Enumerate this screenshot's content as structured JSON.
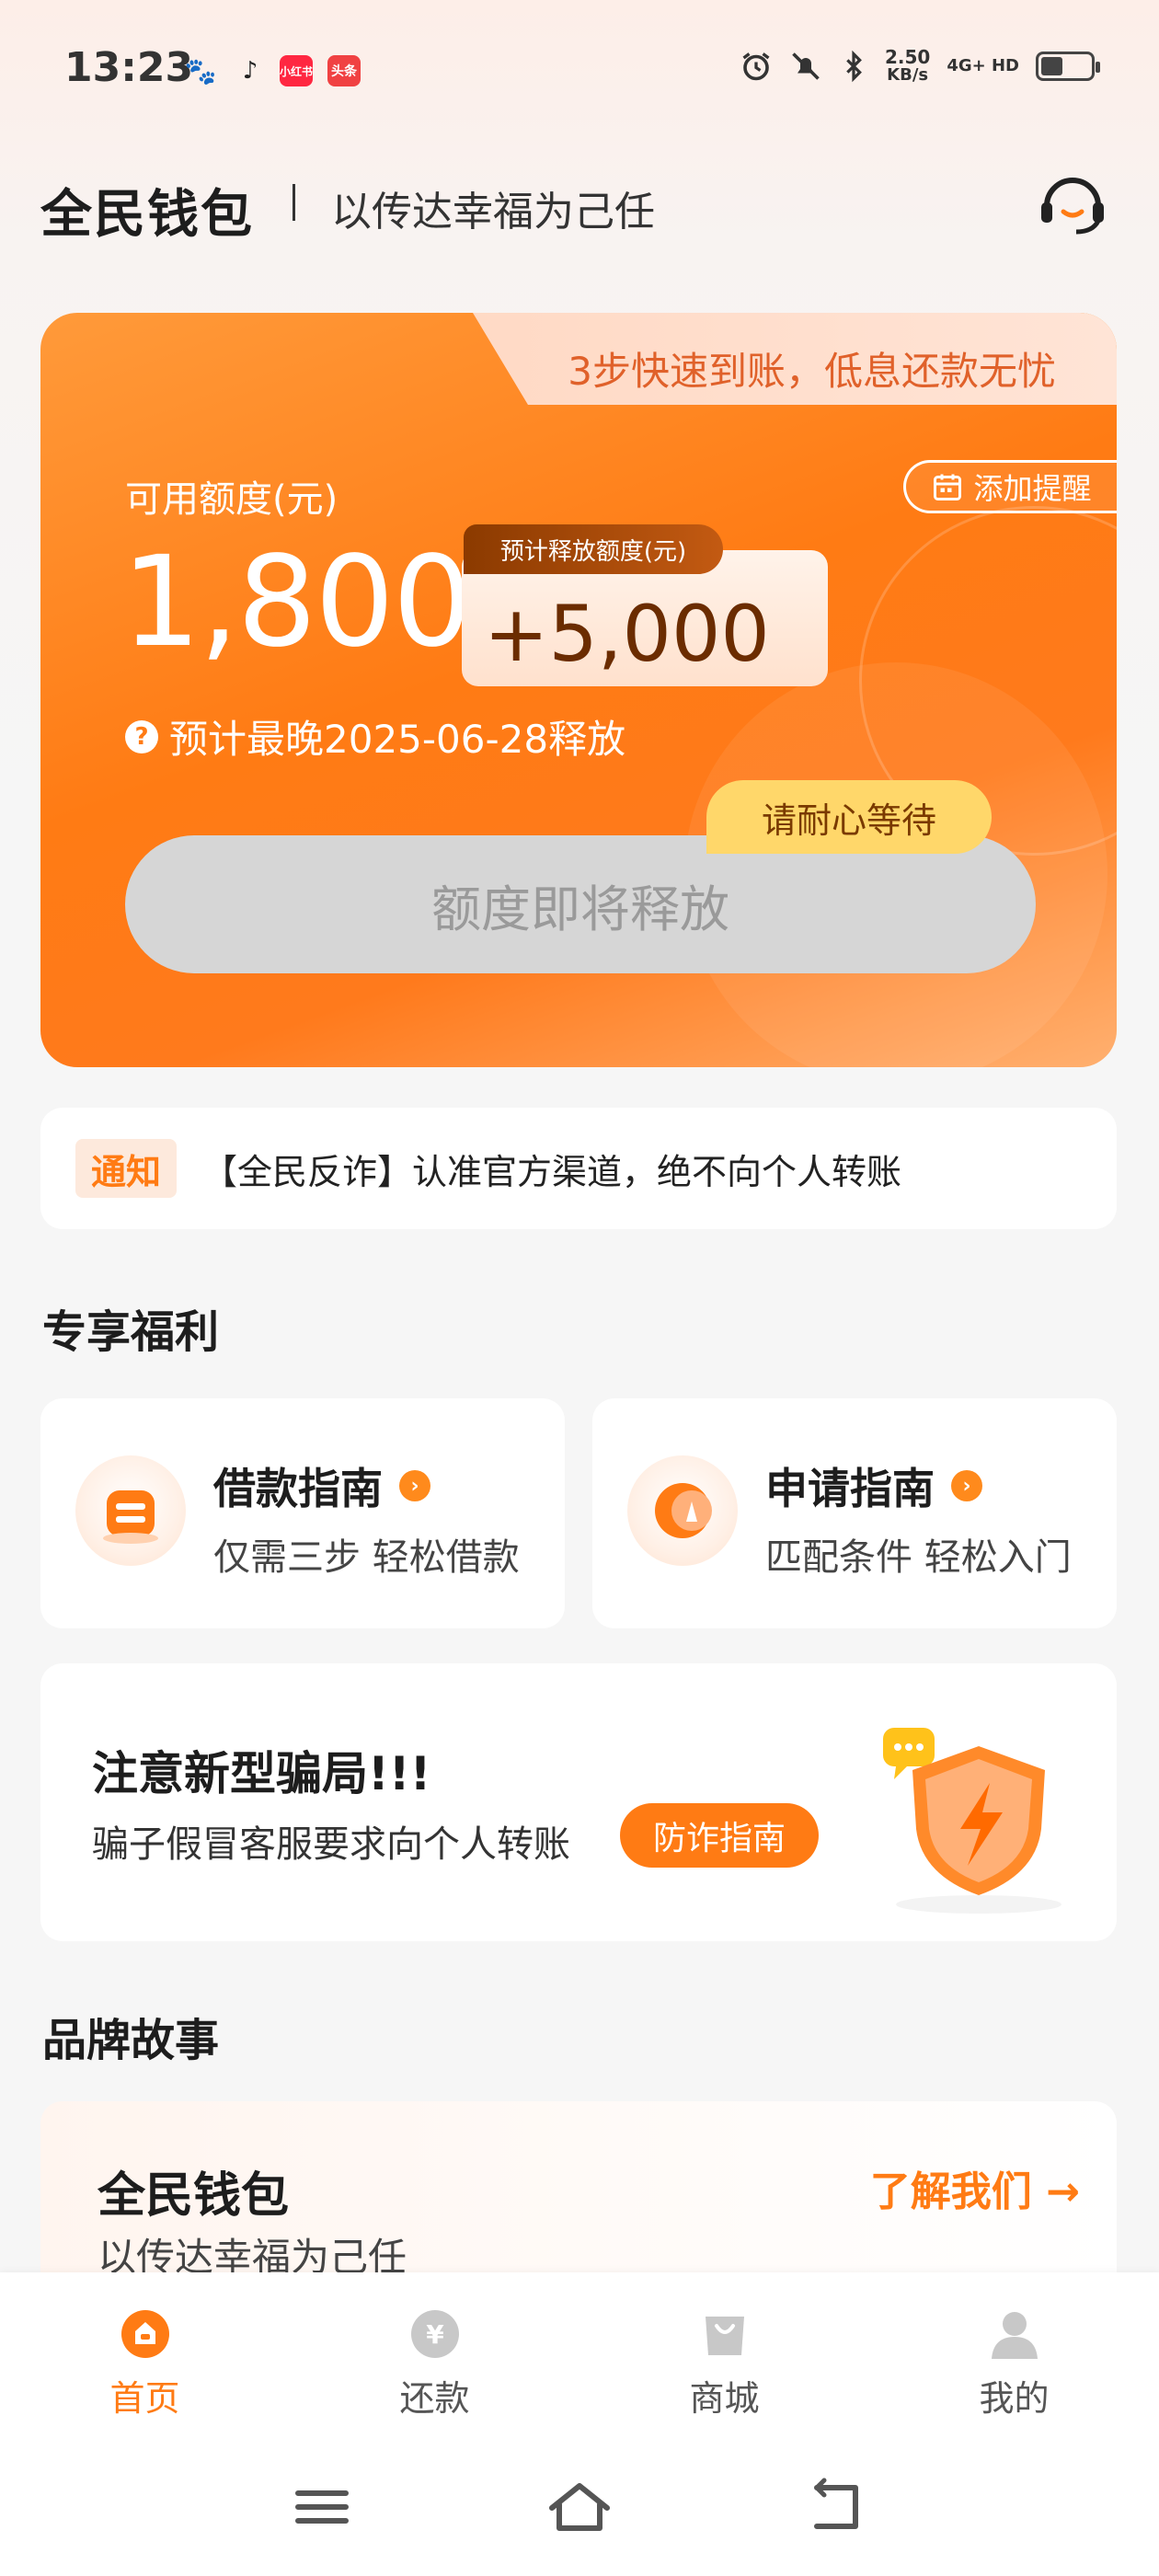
{
  "status_bar": {
    "time": "13:23",
    "apps": [
      "baidu-icon",
      "tiktok-icon",
      "xiaohongshu-icon",
      "toutiao-icon"
    ],
    "app_labels": {
      "xiaohongshu": "小红书",
      "toutiao": "头条"
    },
    "speed_value": "2.50",
    "speed_unit": "KB/s",
    "network": "4G+ HD",
    "battery_level": 0.45
  },
  "header": {
    "brand": "全民钱包",
    "slogan": "以传达幸福为己任",
    "service_icon": "customer-service-icon"
  },
  "credit_card": {
    "tab_text": "3步快速到账，低息还款无忧",
    "remind_label": "添加提醒",
    "available_label": "可用额度(元)",
    "available_amount": "1,800",
    "release_badge": "预计释放额度(元)",
    "release_amount": "+5,000",
    "release_date_text": "预计最晚2025-06-28释放",
    "wait_tag": "请耐心等待",
    "main_button": "额度即将释放"
  },
  "notice": {
    "tag": "通知",
    "text": "【全民反诈】认准官方渠道，绝不向个人转账"
  },
  "benefits": {
    "title": "专享福利",
    "items": [
      {
        "title": "借款指南",
        "subtitle": "仅需三步 轻松借款",
        "icon": "loan-guide-icon"
      },
      {
        "title": "申请指南",
        "subtitle": "匹配条件 轻松入门",
        "icon": "compass-icon"
      }
    ]
  },
  "fraud": {
    "title": "注意新型骗局!!!",
    "subtitle": "骗子假冒客服要求向个人转账",
    "button": "防诈指南"
  },
  "story": {
    "section_title": "品牌故事",
    "title": "全民钱包",
    "subtitle": "以传达幸福为己任",
    "link": "了解我们 →"
  },
  "bottom_nav": [
    {
      "label": "首页",
      "icon": "home-icon",
      "active": true
    },
    {
      "label": "还款",
      "icon": "repay-icon",
      "active": false
    },
    {
      "label": "商城",
      "icon": "mall-icon",
      "active": false
    },
    {
      "label": "我的",
      "icon": "profile-icon",
      "active": false
    }
  ],
  "colors": {
    "accent": "#ff7b14",
    "card_gradient_start": "#ff9a3a",
    "button_disabled": "#d6d6d6",
    "wait_tag": "#ffd76a"
  }
}
